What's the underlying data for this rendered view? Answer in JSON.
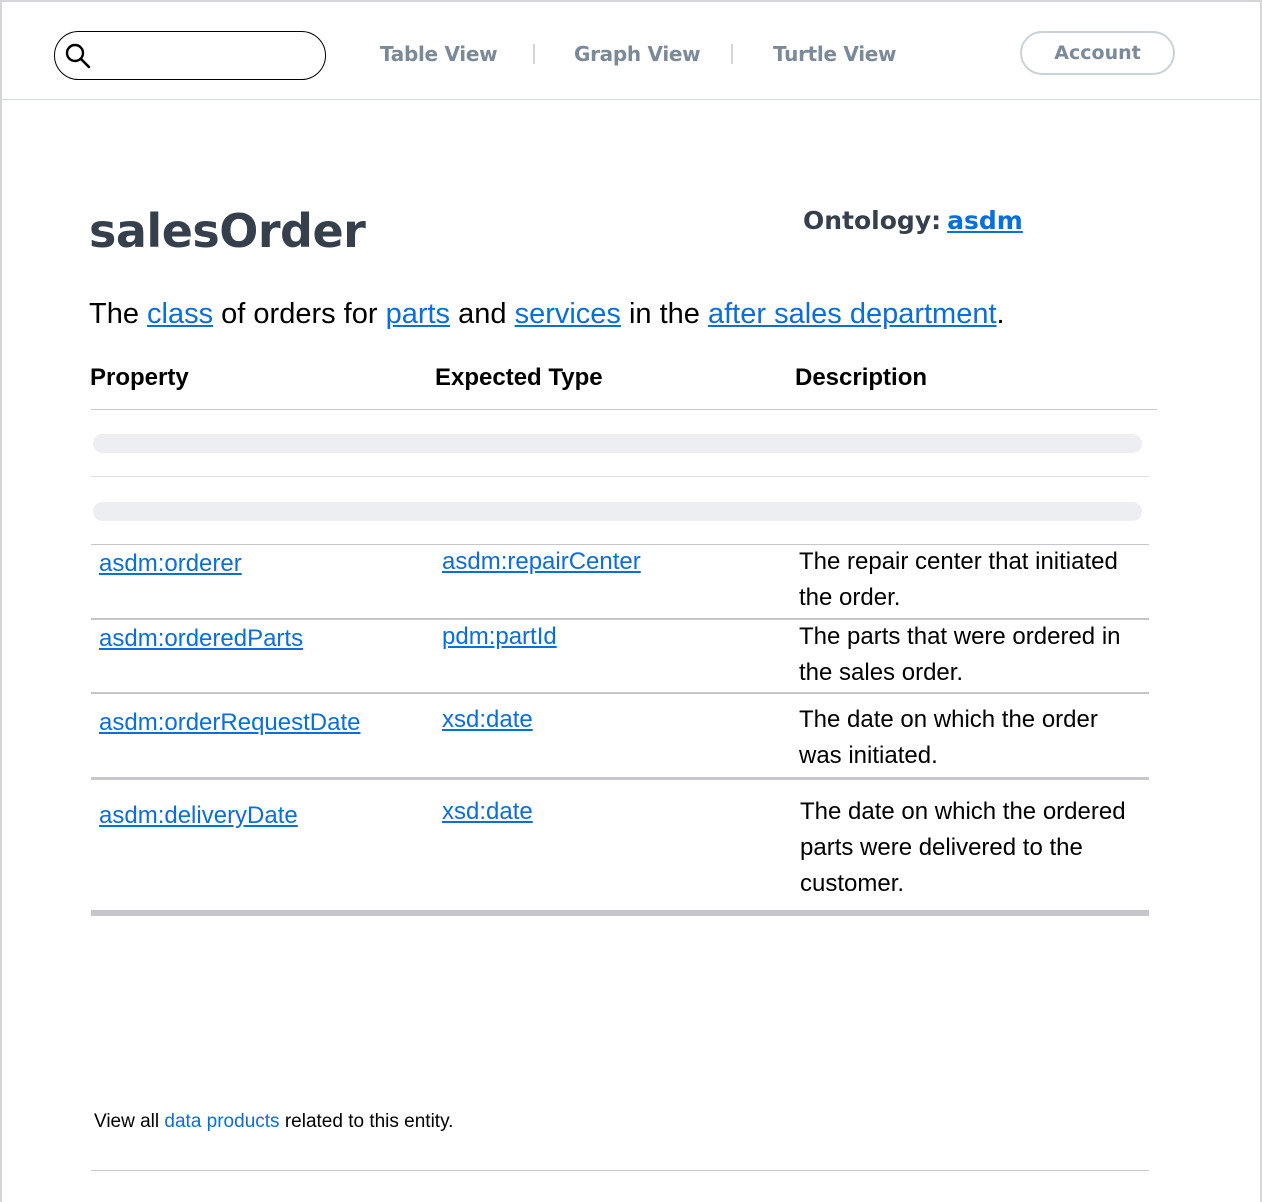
{
  "header": {
    "search": {
      "value": "",
      "placeholder": ""
    },
    "nav": [
      {
        "label": "Table View"
      },
      {
        "label": "Graph View"
      },
      {
        "label": "Turtle View"
      }
    ],
    "account_label": "Account"
  },
  "entity": {
    "title": "salesOrder",
    "ontology_label": "Ontology:",
    "ontology_link": "asdm",
    "description": {
      "t1": "The ",
      "l1": "class",
      "t2": " of orders for ",
      "l2": "parts",
      "t3": " and ",
      "l3": "services",
      "t4": " in the ",
      "l4": "after sales department",
      "t5": "."
    }
  },
  "table": {
    "headers": {
      "property": "Property",
      "type": "Expected Type",
      "description": "Description"
    },
    "rows": [
      {
        "property": "asdm:orderer",
        "type": "asdm:repairCenter",
        "description": "The repair center that initiated the order."
      },
      {
        "property": "asdm:orderedParts",
        "type": "pdm:partId",
        "description": "The parts that were ordered in the sales order."
      },
      {
        "property": "asdm:orderRequestDate",
        "type": "xsd:date",
        "description": "The date on which the order was initiated."
      },
      {
        "property": "asdm:deliveryDate",
        "type": "xsd:date",
        "description": "The date on which the ordered parts were delivered to the customer."
      }
    ]
  },
  "footer": {
    "t1": "View all ",
    "link": "data products",
    "t2": " related to this entity."
  },
  "colors": {
    "link": "#0a6fdc",
    "heading": "#35404c",
    "nav": "#7b8a99"
  }
}
